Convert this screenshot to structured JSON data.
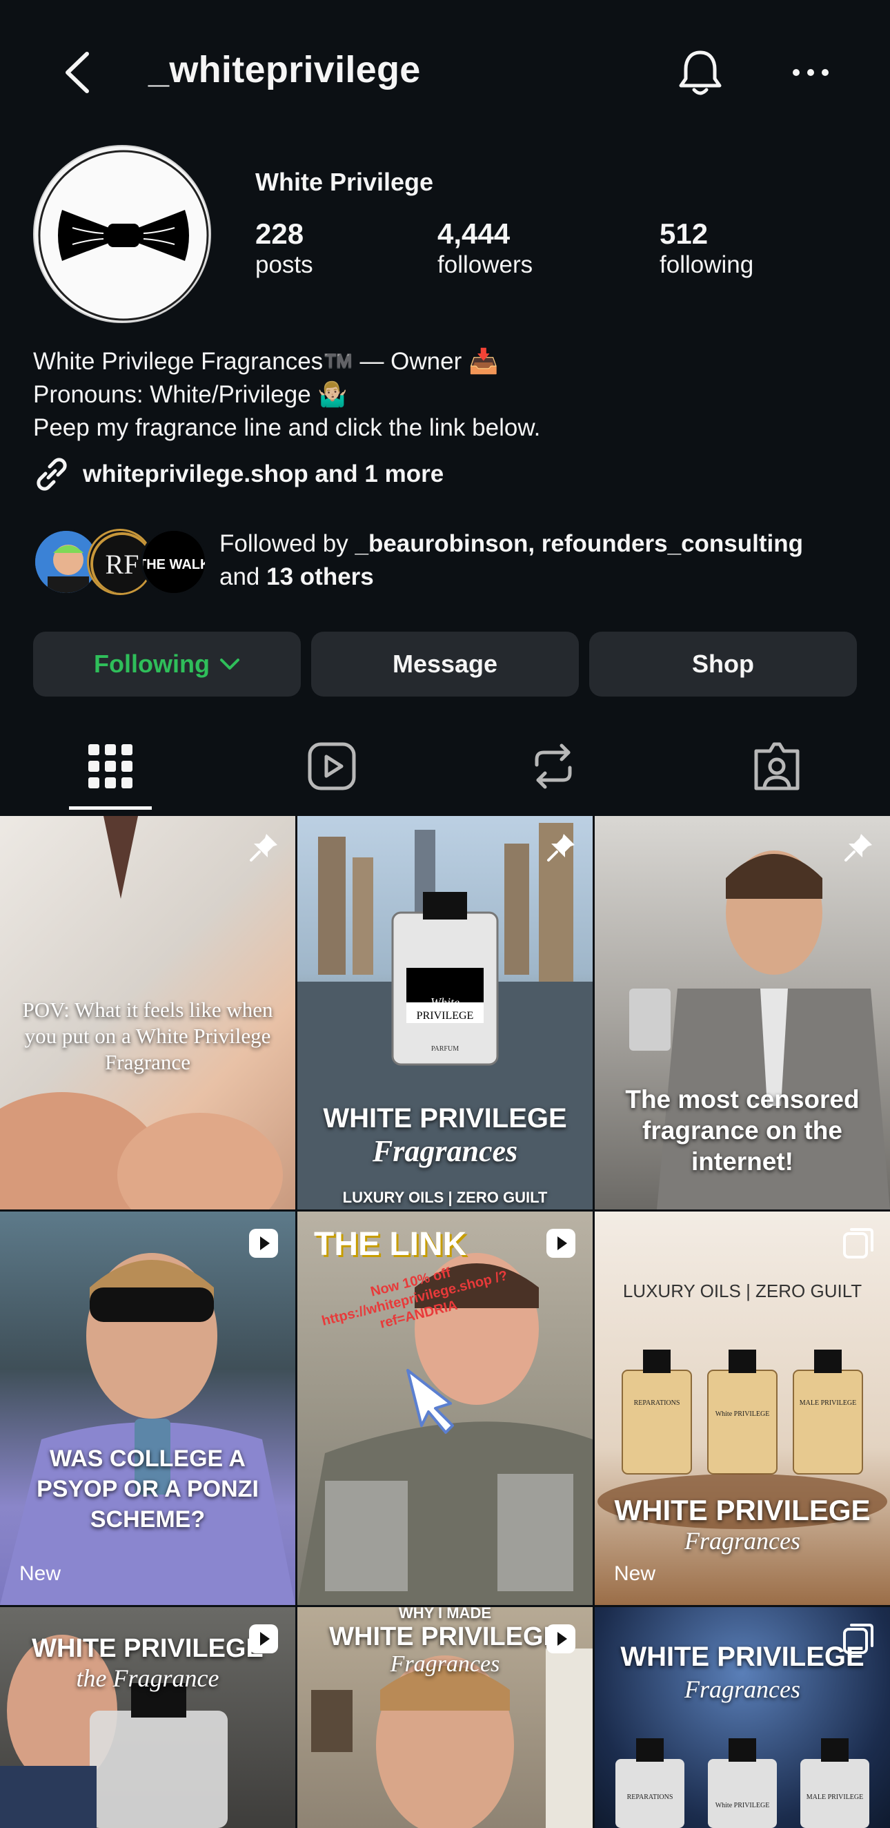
{
  "header": {
    "username": "_whiteprivilege"
  },
  "profile": {
    "display_name": "White Privilege",
    "stats": [
      {
        "num": "228",
        "label": "posts"
      },
      {
        "num": "4,444",
        "label": "followers"
      },
      {
        "num": "512",
        "label": "following"
      }
    ],
    "bio": [
      "White Privilege Fragrances™️ — Owner 📥",
      "Pronouns: White/Privilege 🤷🏼‍♂️",
      "Peep my fragrance line and click the link below."
    ],
    "link": "whiteprivilege.shop and 1 more",
    "followed_by_prefix": "Followed by ",
    "followed_by_names": "_beaurobinson, refounders_consulting",
    "followed_by_and": "and ",
    "followed_by_others": "13 others",
    "rf_avatar_text": "RF",
    "walk_avatar_text": "THE WALK."
  },
  "buttons": {
    "following": "Following",
    "message": "Message",
    "shop": "Shop"
  },
  "colors": {
    "background": "#0c1014",
    "button_bg": "#25292e",
    "following_green": "#2fbe5a"
  },
  "posts": [
    {
      "text": "POV: What it feels like when you put on a White Privilege Fragrance",
      "badge": "pin-icon"
    },
    {
      "text": "WHITE PRIVILEGE",
      "subtext": "Fragrances",
      "footer": "LUXURY OILS | ZERO GUILT",
      "bottle_brand": "White",
      "bottle_name": "PRIVILEGE",
      "bottle_sub": "PARFUM",
      "badge": "pin-icon"
    },
    {
      "text": "The most censored fragrance on the internet!",
      "badge": "pin-icon"
    },
    {
      "text": "WAS COLLEGE A PSYOP OR A PONZI SCHEME?",
      "badge": "reel-icon",
      "label": "New"
    },
    {
      "text": "THE LINK",
      "promo": "Now 10% off https://whiteprivilege.shop /?ref=ANDRIA",
      "badge": "reel-icon"
    },
    {
      "header": "LUXURY OILS | ZERO GUILT",
      "text": "WHITE PRIVILEGE",
      "subtext": "Fragrances",
      "badge": "carousel-icon",
      "label": "New",
      "bottles": [
        "REPARATIONS",
        "White PRIVILEGE",
        "MALE PRIVILEGE"
      ]
    },
    {
      "text": "WHITE PRIVILEGE",
      "subtext": "the Fragrance",
      "badge": "reel-icon"
    },
    {
      "header": "WHY I MADE",
      "text": "WHITE PRIVILEGE",
      "subtext": "Fragrances",
      "badge": "reel-icon"
    },
    {
      "text": "WHITE PRIVILEGE",
      "subtext": "Fragrances",
      "badge": "carousel-icon",
      "bottles": [
        "REPARATIONS",
        "White PRIVILEGE",
        "MALE PRIVILEGE"
      ]
    }
  ]
}
